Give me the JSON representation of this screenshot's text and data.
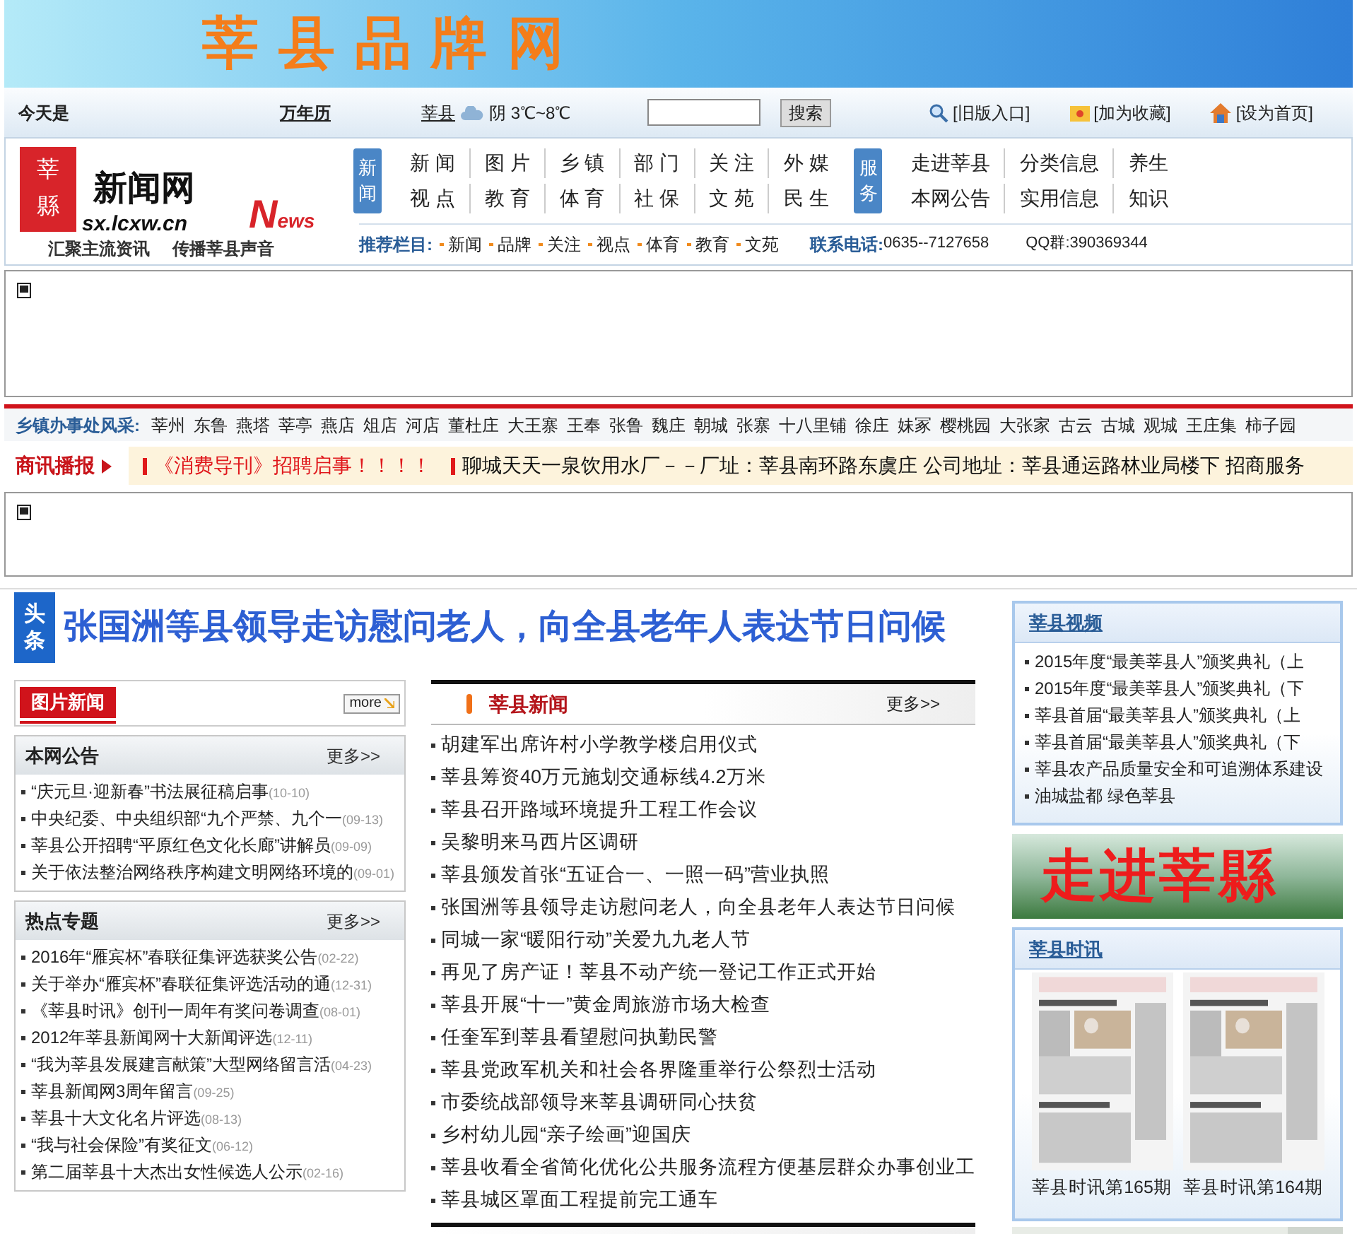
{
  "banner": {
    "title": "莘县品牌网"
  },
  "topbar": {
    "today": "今天是",
    "calendar": "万年历",
    "city": "莘县",
    "weather": "阴 3℃~8℃",
    "search_button": "搜索",
    "links": [
      "[旧版入口]",
      "[加为收藏]",
      "[设为首页]"
    ]
  },
  "logo": {
    "mark_top": "莘",
    "mark_bottom": "縣",
    "name": "新闻网",
    "domain": "sx.lcxw.cn",
    "news_big": "N",
    "news_small": "ews",
    "slogan": [
      "汇聚主流资讯",
      "传播莘县声音"
    ]
  },
  "nav_groups": [
    {
      "label": "新闻",
      "rows": [
        [
          "新 闻",
          "图 片",
          "乡 镇",
          "部 门",
          "关 注",
          "外 媒"
        ],
        [
          "视 点",
          "教 育",
          "体 育",
          "社 保",
          "文 苑",
          "民 生"
        ]
      ]
    },
    {
      "label": "服务",
      "rows": [
        [
          "走进莘县",
          "分类信息",
          "养生"
        ],
        [
          "本网公告",
          "实用信息",
          "知识"
        ]
      ]
    }
  ],
  "recommended": {
    "label": "推荐栏目:",
    "items": [
      "新闻",
      "品牌",
      "关注",
      "视点",
      "体育",
      "教育",
      "文苑"
    ]
  },
  "contact": {
    "label": "联系电话:",
    "phone": "0635--7127658",
    "qq": "QQ群:390369344"
  },
  "towns": {
    "label": "乡镇办事处风采:",
    "items": [
      "莘州",
      "东鲁",
      "燕塔",
      "莘亭",
      "燕店",
      "俎店",
      "河店",
      "董杜庄",
      "大王寨",
      "王奉",
      "张鲁",
      "魏庄",
      "朝城",
      "张寨",
      "十八里铺",
      "徐庄",
      "妹冢",
      "樱桃园",
      "大张家",
      "古云",
      "古城",
      "观城",
      "王庄集",
      "柿子园"
    ]
  },
  "ticker": {
    "label": "商讯播报",
    "items": [
      "《消费导刊》招聘启事！！！！",
      "聊城天天一泉饮用水厂－－厂址：莘县南环路东虞庄  公司地址：莘县通运路林业局楼下  招商服务"
    ]
  },
  "headline": {
    "badge": "头条",
    "title": "张国洲等县领导走访慰问老人，向全县老年人表达节日问候"
  },
  "photo_news": {
    "title": "图片新闻",
    "more": "more"
  },
  "left_sections": [
    {
      "title": "本网公告",
      "more": "更多>>",
      "items": [
        {
          "title": "“庆元旦·迎新春”书法展征稿启事",
          "date": "(10-10)"
        },
        {
          "title": "中央纪委、中央组织部“九个严禁、九个一",
          "date": "(09-13)"
        },
        {
          "title": "莘县公开招聘“平原红色文化长廊”讲解员",
          "date": "(09-09)"
        },
        {
          "title": "关于依法整治网络秩序构建文明网络环境的",
          "date": "(09-01)"
        }
      ]
    },
    {
      "title": "热点专题",
      "more": "更多>>",
      "items": [
        {
          "title": "2016年“雁宾杯”春联征集评选获奖公告",
          "date": "(02-22)"
        },
        {
          "title": "关于举办“雁宾杯”春联征集评选活动的通",
          "date": "(12-31)"
        },
        {
          "title": "《莘县时讯》创刊一周年有奖问卷调查",
          "date": "(08-01)"
        },
        {
          "title": "2012年莘县新闻网十大新闻评选",
          "date": "(12-11)"
        },
        {
          "title": "“我为莘县发展建言献策”大型网络留言活",
          "date": "(04-23)"
        },
        {
          "title": "莘县新闻网3周年留言",
          "date": "(09-25)"
        },
        {
          "title": "莘县十大文化名片评选",
          "date": "(08-13)"
        },
        {
          "title": "“我与社会保险”有奖征文",
          "date": "(06-12)"
        },
        {
          "title": "第二届莘县十大杰出女性候选人公示",
          "date": "(02-16)"
        }
      ]
    }
  ],
  "county_news": {
    "title": "莘县新闻",
    "more": "更多>>",
    "items": [
      "胡建军出席许村小学教学楼启用仪式",
      "莘县筹资40万元施划交通标线4.2万米",
      "莘县召开路域环境提升工程工作会议",
      "吴黎明来马西片区调研",
      "莘县颁发首张“五证合一、一照一码”营业执照",
      "张国洲等县领导走访慰问老人，向全县老年人表达节日问候",
      "同城一家“暖阳行动”关爱九九老人节",
      "再见了房产证！莘县不动产统一登记工作正式开始",
      "莘县开展“十一”黄金周旅游市场大检查",
      "任奎军到莘县看望慰问执勤民警",
      "莘县党政军机关和社会各界隆重举行公祭烈士活动",
      "市委统战部领导来莘县调研同心扶贫",
      "乡村幼儿园“亲子绘画”迎国庆",
      "莘县收看全省简化优化公共服务流程方便基层群众办事创业工",
      "莘县城区罩面工程提前完工通车"
    ]
  },
  "video": {
    "title": "莘县视频",
    "items": [
      "2015年度“最美莘县人”颁奖典礼（上",
      "2015年度“最美莘县人”颁奖典礼（下",
      "莘县首届“最美莘县人”颁奖典礼（上",
      "莘县首届“最美莘县人”颁奖典礼（下",
      "莘县农产品质量安全和可追溯体系建设",
      "油城盐都 绿色莘县"
    ]
  },
  "promo": {
    "title": "走进莘縣"
  },
  "bulletin": {
    "title": "莘县时讯",
    "issues": [
      {
        "kind": "picture",
        "caption": "莘县时讯第165期"
      },
      {
        "kind": "picture",
        "caption": "莘县时讯第164期"
      }
    ]
  }
}
